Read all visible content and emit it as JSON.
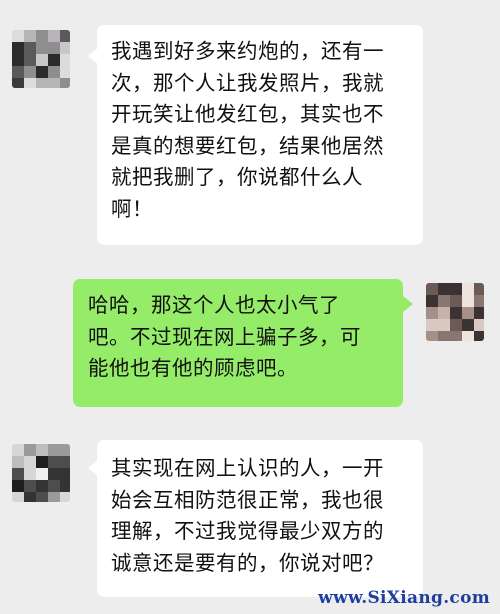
{
  "chat": {
    "messages": [
      {
        "side": "left",
        "lines": [
          "我遇到好多来约炮的，还有一",
          "次，那个人让我发照片，我就",
          "开玩笑让他发红包，其实也不",
          "是真的想要红包，结果他居然",
          "就把我删了，你说都什么人",
          "啊！"
        ]
      },
      {
        "side": "right",
        "lines": [
          "哈哈，那这个人也太小气了",
          "吧。不过现在网上骗子多，可",
          "能他也有他的顾虑吧。"
        ]
      },
      {
        "side": "left",
        "lines": [
          "其实现在网上认识的人，一开",
          "始会互相防范很正常，我也很",
          "理解，不过我觉得最少双方的",
          "诚意还是要有的，你说对吧？"
        ]
      }
    ]
  },
  "watermark": "www.SiXiang.com",
  "colors": {
    "background": "#ededed",
    "left_bubble": "#ffffff",
    "right_bubble": "#95ec69",
    "watermark": "#1f3f9f"
  }
}
